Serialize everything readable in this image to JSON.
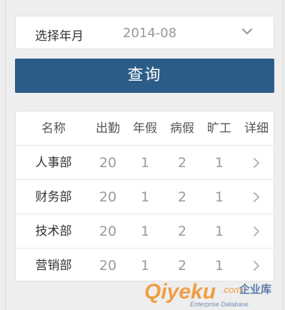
{
  "filter": {
    "label": "选择年月",
    "value": "2014-08",
    "dropdown_icon": "chevron-down-icon"
  },
  "query_button": {
    "label": "查询"
  },
  "table": {
    "columns": [
      "名称",
      "出勤",
      "年假",
      "病假",
      "旷工",
      "详细"
    ],
    "rows": [
      {
        "name": "人事部",
        "attendance": "20",
        "annual_leave": "1",
        "sick_leave": "2",
        "absent": "1"
      },
      {
        "name": "财务部",
        "attendance": "20",
        "annual_leave": "1",
        "sick_leave": "2",
        "absent": "1"
      },
      {
        "name": "技术部",
        "attendance": "20",
        "annual_leave": "1",
        "sick_leave": "2",
        "absent": "1"
      },
      {
        "name": "营销部",
        "attendance": "20",
        "annual_leave": "1",
        "sick_leave": "2",
        "absent": "1"
      }
    ],
    "detail_icon": "chevron-right-icon"
  },
  "watermark": {
    "brand": "Qiyeku",
    "domain": ".com",
    "cn": "企业库",
    "tagline": "Enterprise Database"
  },
  "colors": {
    "primary": "#2c5d88",
    "background": "#eeeeee",
    "card": "#ffffff",
    "muted_text": "#9a9a9a",
    "watermark_orange": "#f08a1c",
    "watermark_blue": "#1c4a8c"
  }
}
